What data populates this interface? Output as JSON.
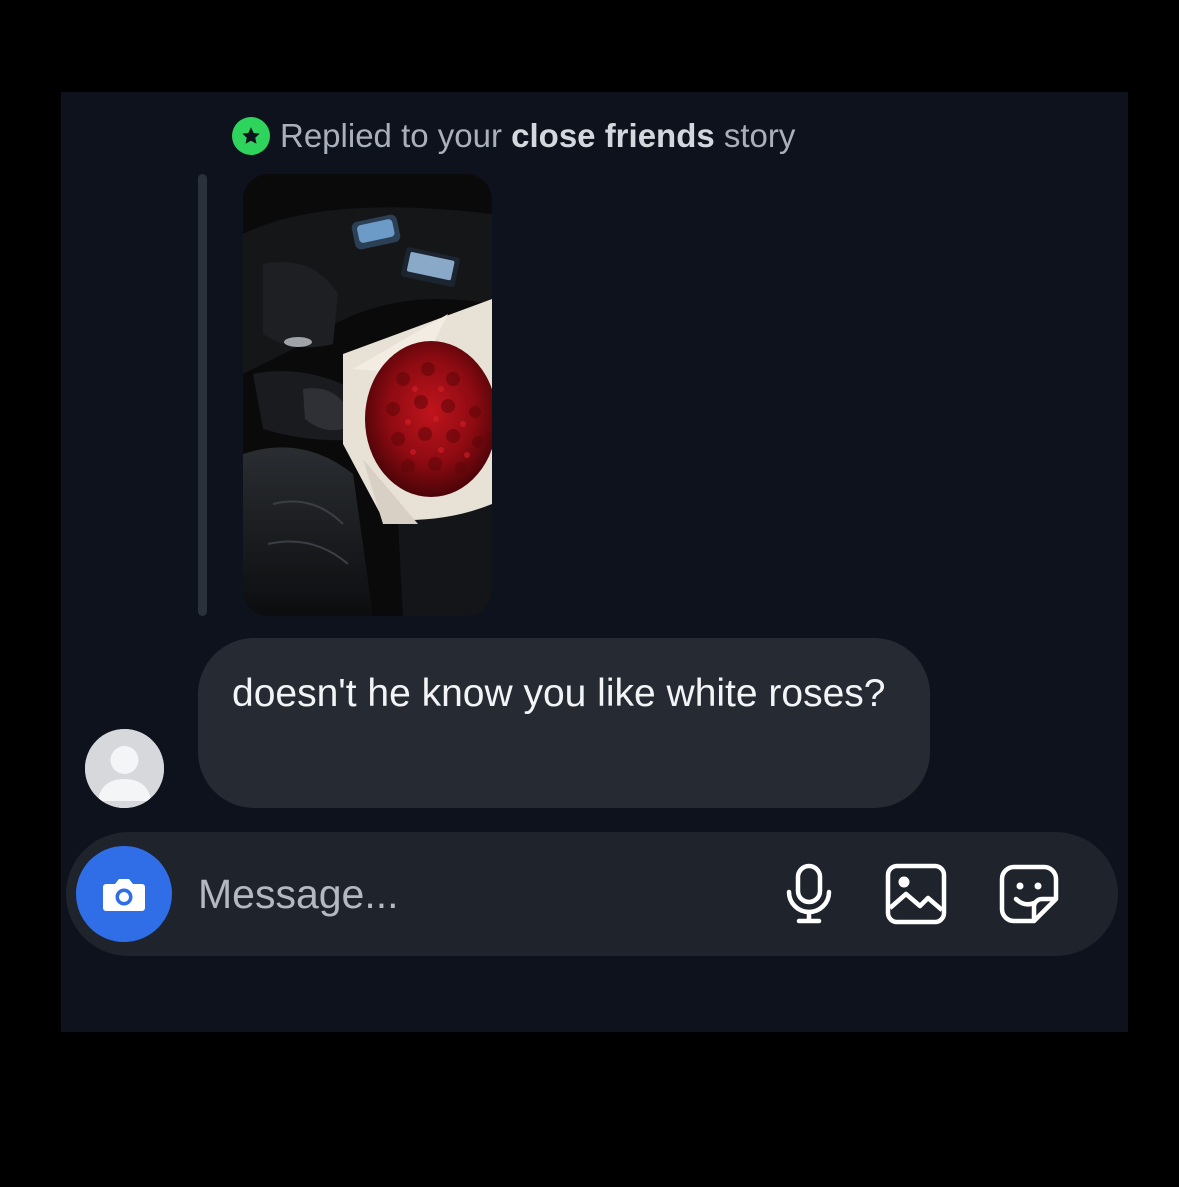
{
  "story_reply": {
    "prefix": "Replied to your ",
    "highlight": "close friends",
    "suffix": " story",
    "badge_icon": "star-icon",
    "badge_color": "#2fd45d"
  },
  "story_thumbnail": {
    "icon": "story-photo"
  },
  "message": {
    "text": "doesn't he know you like white roses?",
    "avatar_icon": "default-avatar-icon"
  },
  "composer": {
    "placeholder": "Message...",
    "camera_icon": "camera-icon",
    "camera_color": "#2f6ee6",
    "tools": [
      "microphone-icon",
      "gallery-icon",
      "sticker-icon"
    ]
  }
}
